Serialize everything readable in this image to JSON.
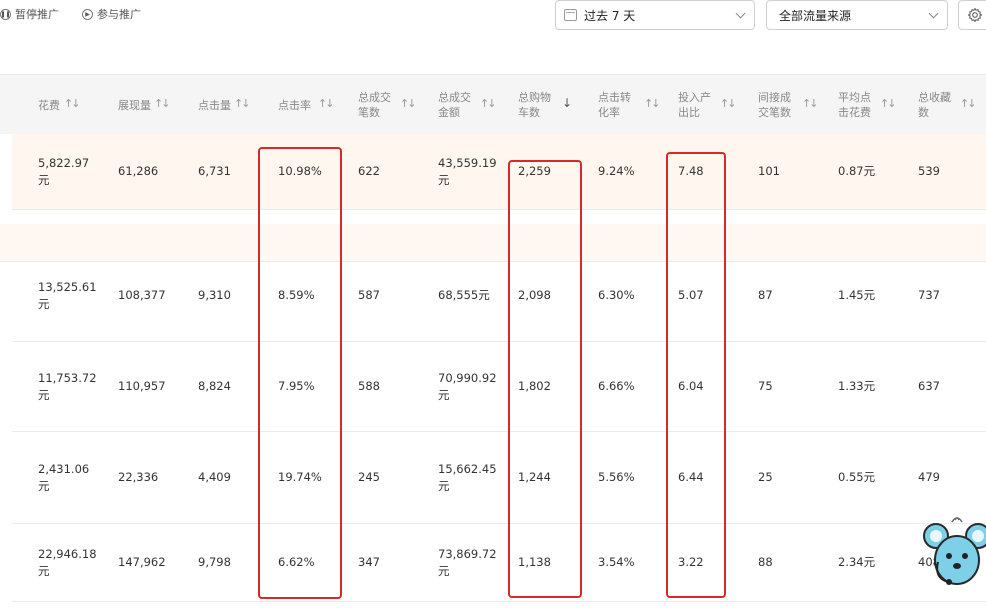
{
  "toolbar": {
    "pause_label": "暂停推广",
    "join_label": "参与推广",
    "date_range": "过去 7 天",
    "traffic_source": "全部流量来源"
  },
  "columns": [
    {
      "key": "cost",
      "label": "花费"
    },
    {
      "key": "impressions",
      "label": "展现量"
    },
    {
      "key": "clicks",
      "label": "点击量"
    },
    {
      "key": "ctr",
      "label": "点击率"
    },
    {
      "key": "orders",
      "label": "总成交\n笔数"
    },
    {
      "key": "gmv",
      "label": "总成交\n金额"
    },
    {
      "key": "carts",
      "label": "总购物\n车数"
    },
    {
      "key": "cvr",
      "label": "点击转\n化率"
    },
    {
      "key": "roi",
      "label": "投入产\n出比"
    },
    {
      "key": "indirect",
      "label": "间接成\n交笔数"
    },
    {
      "key": "cpc",
      "label": "平均点\n击花费"
    },
    {
      "key": "favs",
      "label": "总收藏\n数"
    }
  ],
  "rows": [
    {
      "cost": "5,822.97\n元",
      "impressions": "61,286",
      "clicks": "6,731",
      "ctr": "10.98%",
      "orders": "622",
      "gmv": "43,559.19\n元",
      "carts": "2,259",
      "cvr": "9.24%",
      "roi": "7.48",
      "indirect": "101",
      "cpc": "0.87元",
      "favs": "539"
    },
    {
      "cost": "13,525.61\n元",
      "impressions": "108,377",
      "clicks": "9,310",
      "ctr": "8.59%",
      "orders": "587",
      "gmv": "68,555元",
      "carts": "2,098",
      "cvr": "6.30%",
      "roi": "5.07",
      "indirect": "87",
      "cpc": "1.45元",
      "favs": "737"
    },
    {
      "cost": "11,753.72\n元",
      "impressions": "110,957",
      "clicks": "8,824",
      "ctr": "7.95%",
      "orders": "588",
      "gmv": "70,990.92\n元",
      "carts": "1,802",
      "cvr": "6.66%",
      "roi": "6.04",
      "indirect": "75",
      "cpc": "1.33元",
      "favs": "637"
    },
    {
      "cost": "2,431.06\n元",
      "impressions": "22,336",
      "clicks": "4,409",
      "ctr": "19.74%",
      "orders": "245",
      "gmv": "15,662.45\n元",
      "carts": "1,244",
      "cvr": "5.56%",
      "roi": "6.44",
      "indirect": "25",
      "cpc": "0.55元",
      "favs": "479"
    },
    {
      "cost": "22,946.18\n元",
      "impressions": "147,962",
      "clicks": "9,798",
      "ctr": "6.62%",
      "orders": "347",
      "gmv": "73,869.72\n元",
      "carts": "1,138",
      "cvr": "3.54%",
      "roi": "3.22",
      "indirect": "88",
      "cpc": "2.34元",
      "favs": "408"
    }
  ],
  "colors": {
    "highlight_box": "#d32a2a",
    "highlight_row": "#fff7ef",
    "header_bg": "#f5f5f5"
  }
}
